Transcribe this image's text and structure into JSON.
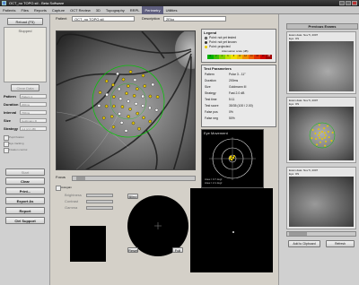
{
  "window": {
    "title": "OCT_no TOPO.stl - Beta Software"
  },
  "menu": {
    "items": [
      "Patients",
      "Files",
      "Reports",
      "Capture",
      "OCT Review",
      "3D",
      "Topography",
      "RRPL",
      "Perimetry",
      "Utilities"
    ],
    "active_index": 8
  },
  "left": {
    "reload_label": "Reload (F5)",
    "slot_label": "Stopped",
    "clear_label": "Clear Data",
    "fields": [
      {
        "label": "Pattern",
        "value": "Pattern 1"
      },
      {
        "label": "Duration",
        "value": "200ms"
      },
      {
        "label": "Interval",
        "value": "700ms"
      },
      {
        "label": "Size",
        "value": "Goldmann III"
      },
      {
        "label": "Strategy",
        "value": "4-2 (2.0 dB)"
      }
    ],
    "checkboxes": [
      "Pupil fixation",
      "Eye tracking",
      "Fixation control"
    ],
    "buttons": [
      "Start",
      "Clear",
      "Print...",
      "Export As",
      "Report",
      "Ctrl Support"
    ]
  },
  "center": {
    "patient_label": "Patient",
    "patient_value": "OCT_no TOPO.stl",
    "description_label": "Description",
    "description_value": "2Eko",
    "focus_label": "Focus",
    "autogain_label": "Autogain",
    "brightness_label": "Brightness",
    "contrast_label": "Contrast",
    "gamma_label": "Gamma",
    "tool_labels": [
      "Blind",
      "Reset",
      "Full"
    ]
  },
  "legend": {
    "title": "Legend",
    "items": [
      "Point: not yet tested",
      "Point: not yet known",
      "Point: projected"
    ],
    "scale_label": "Attenuation scale (dB)",
    "scale_values": [
      "0",
      "2",
      "4",
      "6",
      "8",
      "10",
      "12",
      "14",
      "16",
      "18",
      "20"
    ]
  },
  "test_params": {
    "title": "Test Parameters",
    "rows": [
      {
        "k": "Pattern",
        "v": "Polar 3 - 11°"
      },
      {
        "k": "Duration",
        "v": "200ms"
      },
      {
        "k": "Size",
        "v": "Goldmann III"
      },
      {
        "k": "Strategy",
        "v": "Fast 2.0 dB"
      },
      {
        "k": "Test time",
        "v": "5:11"
      },
      {
        "k": "Test score",
        "v": "35/35 (100 / 2.00)"
      },
      {
        "k": "False pos",
        "v": "0%"
      },
      {
        "k": "False neg",
        "v": "50%"
      }
    ]
  },
  "eye_movement": {
    "title": "Eye Movement",
    "readouts": [
      "Area = 0.7 deg²",
      "Area = 2.1 deg²"
    ]
  },
  "previous": {
    "title": "Previous Exams",
    "exams": [
      {
        "date_label": "Exam date",
        "date": "Nov 5, 2007",
        "eye_label": "Eye",
        "eye": "OS"
      },
      {
        "date_label": "Exam date",
        "date": "Nov 5, 2007",
        "eye_label": "Eye",
        "eye": "OS"
      },
      {
        "date_label": "Exam date",
        "date": "Nov 5, 2007",
        "eye_label": "Eye",
        "eye": "OS"
      }
    ],
    "add_label": "Add to Clipboard",
    "refresh_label": "Refresh"
  },
  "colors": {
    "menu_active": "#606080",
    "fixation_marker": "#e6c800",
    "scale_low": "#00b000",
    "scale_high": "#d00000"
  }
}
